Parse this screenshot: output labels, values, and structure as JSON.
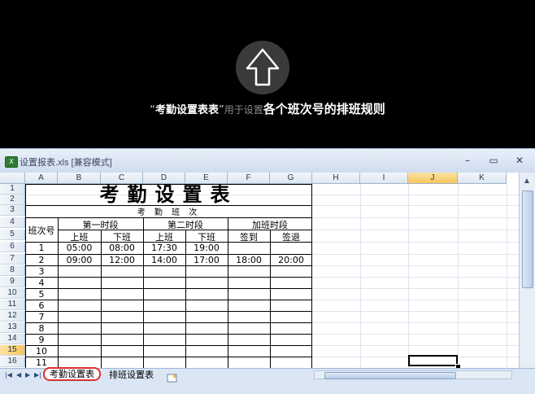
{
  "banner": {
    "quote_open": "“",
    "name": "考勤设置表表",
    "quote_close": "”",
    "middle": "用于设置",
    "emphasis": "各个班次号的排班规则"
  },
  "window": {
    "title": "设置报表.xls  [兼容模式]",
    "controls": [
      "–",
      "▭",
      "✕"
    ]
  },
  "columns": [
    "A",
    "B",
    "C",
    "D",
    "E",
    "F",
    "G",
    "H",
    "I",
    "J",
    "K"
  ],
  "rows": [
    "1",
    "2",
    "3",
    "4",
    "5",
    "6",
    "7",
    "8",
    "9",
    "10",
    "11",
    "12",
    "13",
    "14",
    "15",
    "16"
  ],
  "active_column": "J",
  "active_row": "15",
  "sheet": {
    "title": "考勤设置表",
    "subtitle": "考 勤 班 次",
    "shift_no_header": "班次号",
    "group_headers": [
      "第一时段",
      "第二时段",
      "加班时段"
    ],
    "sub_headers": [
      "上班",
      "下班",
      "上班",
      "下班",
      "签到",
      "签退"
    ],
    "data_rows": [
      {
        "no": "1",
        "cells": [
          "05:00",
          "08:00",
          "17:30",
          "19:00",
          "",
          ""
        ]
      },
      {
        "no": "2",
        "cells": [
          "09:00",
          "12:00",
          "14:00",
          "17:00",
          "18:00",
          "20:00"
        ]
      },
      {
        "no": "3",
        "cells": [
          "",
          "",
          "",
          "",
          "",
          ""
        ]
      },
      {
        "no": "4",
        "cells": [
          "",
          "",
          "",
          "",
          "",
          ""
        ]
      },
      {
        "no": "5",
        "cells": [
          "",
          "",
          "",
          "",
          "",
          ""
        ]
      },
      {
        "no": "6",
        "cells": [
          "",
          "",
          "",
          "",
          "",
          ""
        ]
      },
      {
        "no": "7",
        "cells": [
          "",
          "",
          "",
          "",
          "",
          ""
        ]
      },
      {
        "no": "8",
        "cells": [
          "",
          "",
          "",
          "",
          "",
          ""
        ]
      },
      {
        "no": "9",
        "cells": [
          "",
          "",
          "",
          "",
          "",
          ""
        ]
      },
      {
        "no": "10",
        "cells": [
          "",
          "",
          "",
          "",
          "",
          ""
        ]
      },
      {
        "no": "11",
        "cells": [
          "",
          "",
          "",
          "",
          "",
          ""
        ]
      }
    ]
  },
  "tabs": {
    "nav": [
      "|◀",
      "◀",
      "▶",
      "▶|"
    ],
    "items": [
      {
        "label": "考勤设置表",
        "active": true
      },
      {
        "label": "排班设置表",
        "active": false
      }
    ]
  },
  "colors": {
    "highlight_tab_border": "#e03030",
    "active_header": "#f6c55a"
  }
}
